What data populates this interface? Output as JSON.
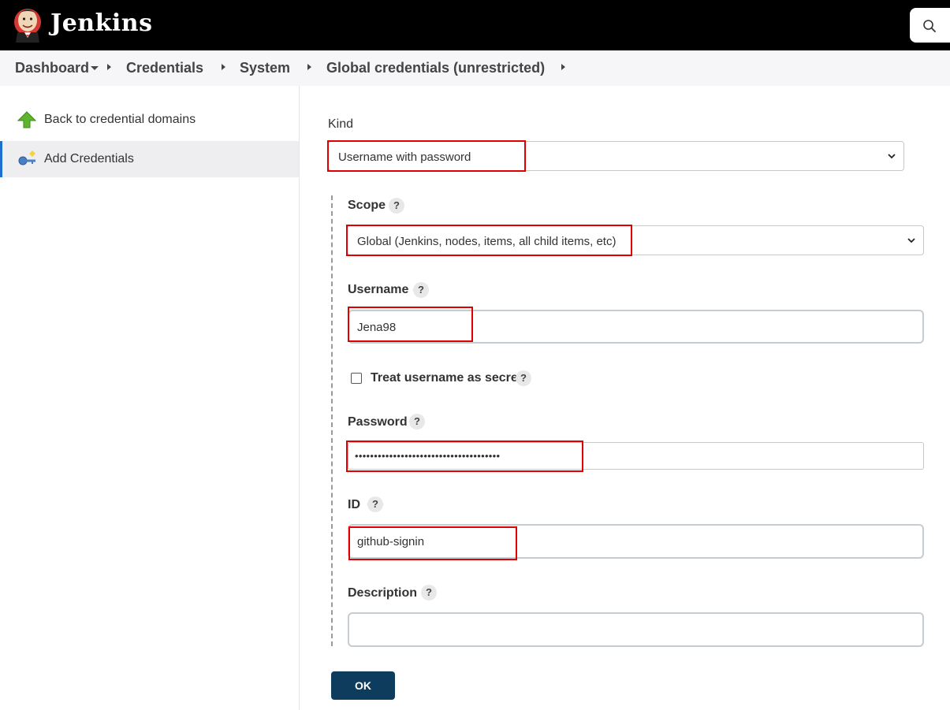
{
  "header": {
    "brand": "Jenkins",
    "logo_icon": "jenkins-butler-icon",
    "search_icon": "search-icon"
  },
  "breadcrumb": {
    "items": [
      "Dashboard",
      "Credentials",
      "System",
      "Global credentials (unrestricted)"
    ]
  },
  "sidebar": {
    "items": [
      {
        "label": "Back to credential domains",
        "icon": "up-arrow-icon"
      },
      {
        "label": "Add Credentials",
        "icon": "key-icon"
      }
    ]
  },
  "form": {
    "kind": {
      "label": "Kind",
      "value": "Username with password"
    },
    "scope": {
      "label": "Scope",
      "value": "Global (Jenkins, nodes, items, all child items, etc)"
    },
    "username": {
      "label": "Username",
      "value": "Jena98"
    },
    "treat_secret": {
      "label": "Treat username as secret",
      "checked": false
    },
    "password": {
      "label": "Password",
      "value": "••••••••••••••••••••••••••••••••••••••"
    },
    "id": {
      "label": "ID",
      "value": "github-signin"
    },
    "description": {
      "label": "Description",
      "value": ""
    },
    "help": "?",
    "ok_label": "OK"
  },
  "colors": {
    "header_bg": "#000000",
    "accent": "#0d3c5c",
    "highlight": "#e00000"
  }
}
